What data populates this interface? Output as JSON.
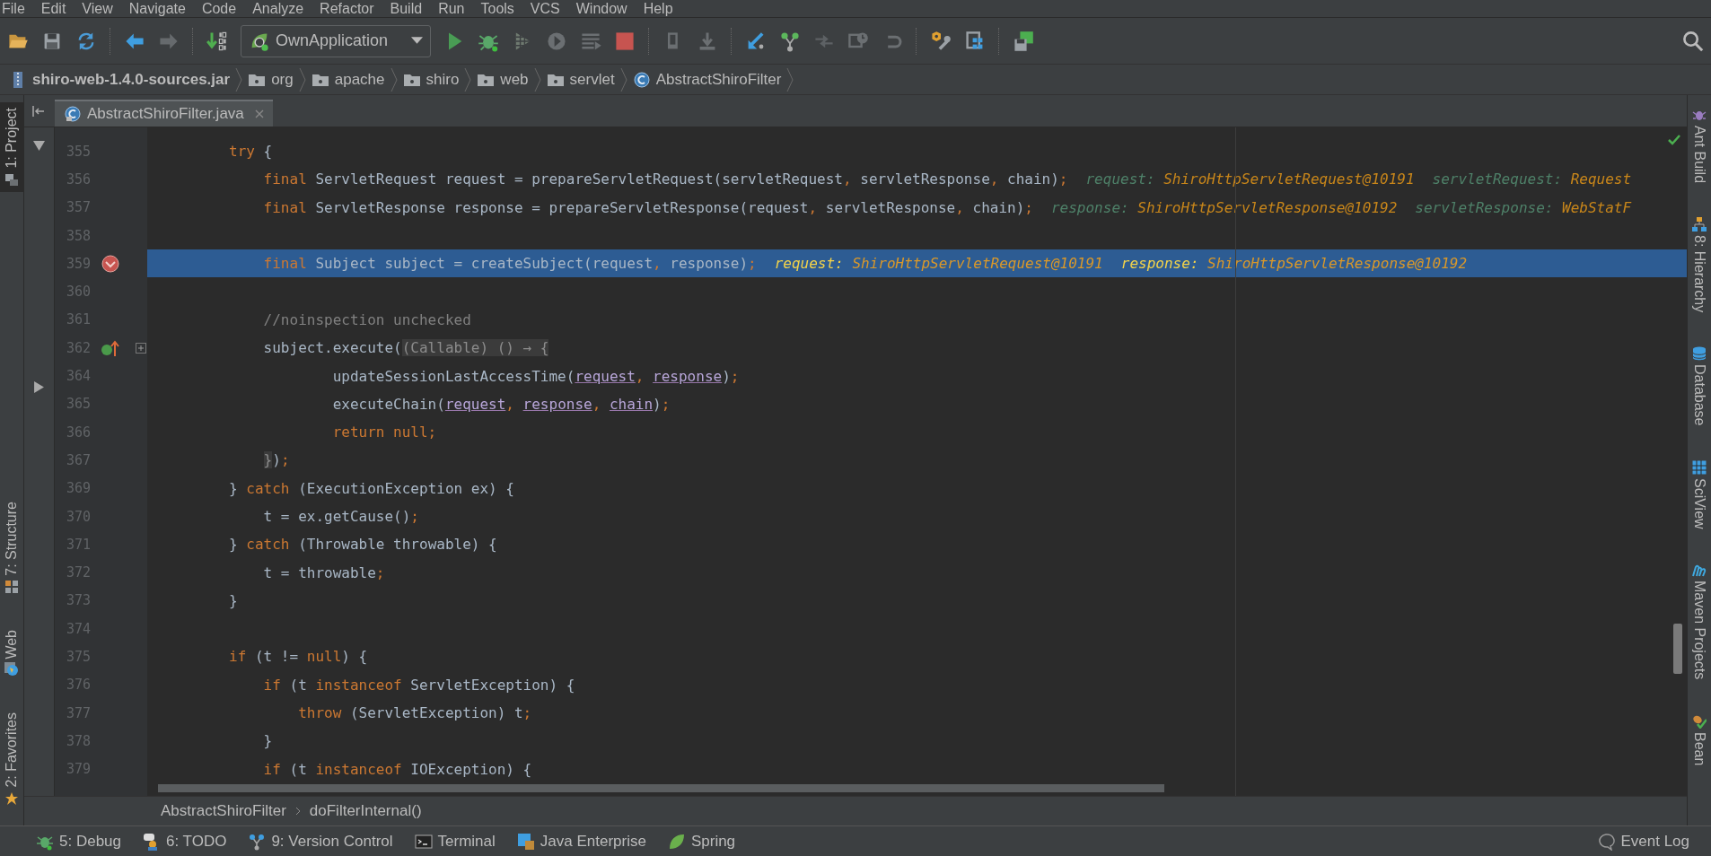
{
  "menu": [
    "File",
    "Edit",
    "View",
    "Navigate",
    "Code",
    "Analyze",
    "Refactor",
    "Build",
    "Run",
    "Tools",
    "VCS",
    "Window",
    "Help"
  ],
  "run_config": "OwnApplication",
  "navigation": [
    {
      "label": "shiro-web-1.4.0-sources.jar",
      "kind": "jar"
    },
    {
      "label": "org",
      "kind": "package"
    },
    {
      "label": "apache",
      "kind": "package"
    },
    {
      "label": "shiro",
      "kind": "package"
    },
    {
      "label": "web",
      "kind": "package"
    },
    {
      "label": "servlet",
      "kind": "package"
    },
    {
      "label": "AbstractShiroFilter",
      "kind": "class"
    }
  ],
  "left_tools": [
    {
      "label": "1: Project",
      "kind": "project",
      "selected": true
    },
    {
      "label": "7: Structure",
      "kind": "structure",
      "selected": false
    },
    {
      "label": "Web",
      "kind": "web",
      "selected": false
    },
    {
      "label": "2: Favorites",
      "kind": "favorites",
      "selected": false
    }
  ],
  "right_tools": [
    {
      "label": "Ant Build",
      "kind": "ant"
    },
    {
      "label": "8: Hierarchy",
      "kind": "hierarchy"
    },
    {
      "label": "Database",
      "kind": "database"
    },
    {
      "label": "SciView",
      "kind": "sciview"
    },
    {
      "label": "Maven Projects",
      "kind": "maven"
    },
    {
      "label": "Bean",
      "kind": "bean"
    }
  ],
  "tabs": [
    {
      "label": "AbstractShiroFilter.java",
      "selected": true
    }
  ],
  "lines": [
    {
      "number": "355",
      "selected": false,
      "fold": false,
      "breakpoint": false,
      "override": false,
      "tokens": [
        {
          "text": "        try",
          "kind": "kw"
        },
        {
          "text": " {",
          "kind": "id"
        }
      ]
    },
    {
      "number": "356",
      "selected": false,
      "fold": false,
      "breakpoint": false,
      "override": false,
      "tokens": [
        {
          "text": "            final",
          "kind": "kw"
        },
        {
          "text": " ServletRequest request = prepareServletRequest(servletRequest",
          "kind": "id"
        },
        {
          "text": ",",
          "kind": "p"
        },
        {
          "text": " servletResponse",
          "kind": "id"
        },
        {
          "text": ",",
          "kind": "p"
        },
        {
          "text": " chain)",
          "kind": "id"
        },
        {
          "text": ";",
          "kind": "p"
        }
      ],
      "hints": [
        {
          "label": "request:",
          "value": "ShiroHttpServletRequest@10191"
        },
        {
          "label": "servletRequest:",
          "value": "Request"
        }
      ]
    },
    {
      "number": "357",
      "selected": false,
      "fold": false,
      "breakpoint": false,
      "override": false,
      "tokens": [
        {
          "text": "            final",
          "kind": "kw"
        },
        {
          "text": " ServletResponse response = prepareServletResponse(request",
          "kind": "id"
        },
        {
          "text": ",",
          "kind": "p"
        },
        {
          "text": " servletResponse",
          "kind": "id"
        },
        {
          "text": ",",
          "kind": "p"
        },
        {
          "text": " chain)",
          "kind": "id"
        },
        {
          "text": ";",
          "kind": "p"
        }
      ],
      "hints": [
        {
          "label": "response:",
          "value": "ShiroHttpServletResponse@10192"
        },
        {
          "label": "servletResponse:",
          "value": "WebStatF"
        }
      ]
    },
    {
      "number": "358",
      "selected": false,
      "fold": false,
      "breakpoint": false,
      "override": false
    },
    {
      "number": "359",
      "selected": true,
      "fold": false,
      "breakpoint": true,
      "override": false,
      "tokens": [
        {
          "text": "            final",
          "kind": "kw"
        },
        {
          "text": " Subject subject = createSubject(request",
          "kind": "id"
        },
        {
          "text": ",",
          "kind": "p"
        },
        {
          "text": " response)",
          "kind": "id"
        },
        {
          "text": ";",
          "kind": "p"
        }
      ],
      "hints": [
        {
          "label": "request:",
          "value": "ShiroHttpServletRequest@10191"
        },
        {
          "label": "response:",
          "value": "ShiroHttpServletResponse@10192"
        }
      ]
    },
    {
      "number": "360",
      "selected": false,
      "fold": false,
      "breakpoint": false,
      "override": false
    },
    {
      "number": "361",
      "selected": false,
      "fold": false,
      "breakpoint": false,
      "override": false,
      "tokens": [
        {
          "text": "            //noinspection unchecked",
          "kind": "comment"
        }
      ]
    },
    {
      "number": "362",
      "selected": false,
      "fold": true,
      "breakpoint": false,
      "override": true,
      "tokens": [
        {
          "text": "            subject.execute(",
          "kind": "id"
        },
        {
          "text": "(Callable) () → {",
          "kind": "fold"
        }
      ]
    },
    {
      "number": "364",
      "selected": false,
      "fold": false,
      "breakpoint": false,
      "override": false,
      "tokens": [
        {
          "text": "                    updateSessionLastAccessTime(",
          "kind": "id"
        },
        {
          "text": "request",
          "kind": "param"
        },
        {
          "text": ", ",
          "kind": "p"
        },
        {
          "text": "response",
          "kind": "param"
        },
        {
          "text": ")",
          "kind": "id"
        },
        {
          "text": ";",
          "kind": "p"
        }
      ]
    },
    {
      "number": "365",
      "selected": false,
      "fold": false,
      "breakpoint": false,
      "override": false,
      "tokens": [
        {
          "text": "                    executeChain(",
          "kind": "id"
        },
        {
          "text": "request",
          "kind": "param"
        },
        {
          "text": ", ",
          "kind": "p"
        },
        {
          "text": "response",
          "kind": "param"
        },
        {
          "text": ", ",
          "kind": "p"
        },
        {
          "text": "chain",
          "kind": "param"
        },
        {
          "text": ")",
          "kind": "id"
        },
        {
          "text": ";",
          "kind": "p"
        }
      ]
    },
    {
      "number": "366",
      "selected": false,
      "fold": false,
      "breakpoint": false,
      "override": false,
      "tokens": [
        {
          "text": "                    return null;",
          "kind": "kw"
        }
      ]
    },
    {
      "number": "367",
      "selected": false,
      "fold": false,
      "breakpoint": false,
      "override": false,
      "tokens": [
        {
          "text": "            }",
          "kind": "fold"
        },
        {
          "text": ")",
          "kind": "id"
        },
        {
          "text": ";",
          "kind": "p"
        }
      ]
    },
    {
      "number": "369",
      "selected": false,
      "fold": false,
      "breakpoint": false,
      "override": false,
      "tokens": [
        {
          "text": "        } ",
          "kind": "id"
        },
        {
          "text": "catch",
          "kind": "kw"
        },
        {
          "text": " (ExecutionException ex) {",
          "kind": "id"
        }
      ]
    },
    {
      "number": "370",
      "selected": false,
      "fold": false,
      "breakpoint": false,
      "override": false,
      "tokens": [
        {
          "text": "            t = ex.getCause()",
          "kind": "id"
        },
        {
          "text": ";",
          "kind": "p"
        }
      ]
    },
    {
      "number": "371",
      "selected": false,
      "fold": false,
      "breakpoint": false,
      "override": false,
      "tokens": [
        {
          "text": "        } ",
          "kind": "id"
        },
        {
          "text": "catch",
          "kind": "kw"
        },
        {
          "text": " (Throwable throwable) {",
          "kind": "id"
        }
      ]
    },
    {
      "number": "372",
      "selected": false,
      "fold": false,
      "breakpoint": false,
      "override": false,
      "tokens": [
        {
          "text": "            t = throwable",
          "kind": "id"
        },
        {
          "text": ";",
          "kind": "p"
        }
      ]
    },
    {
      "number": "373",
      "selected": false,
      "fold": false,
      "breakpoint": false,
      "override": false,
      "tokens": [
        {
          "text": "        }",
          "kind": "id"
        }
      ]
    },
    {
      "number": "374",
      "selected": false,
      "fold": false,
      "breakpoint": false,
      "override": false
    },
    {
      "number": "375",
      "selected": false,
      "fold": false,
      "breakpoint": false,
      "override": false,
      "tokens": [
        {
          "text": "        if",
          "kind": "kw"
        },
        {
          "text": " (t != ",
          "kind": "id"
        },
        {
          "text": "null",
          "kind": "kw"
        },
        {
          "text": ") {",
          "kind": "id"
        }
      ]
    },
    {
      "number": "376",
      "selected": false,
      "fold": false,
      "breakpoint": false,
      "override": false,
      "tokens": [
        {
          "text": "            if",
          "kind": "kw"
        },
        {
          "text": " (t ",
          "kind": "id"
        },
        {
          "text": "instanceof",
          "kind": "kw"
        },
        {
          "text": " ServletException) {",
          "kind": "id"
        }
      ]
    },
    {
      "number": "377",
      "selected": false,
      "fold": false,
      "breakpoint": false,
      "override": false,
      "tokens": [
        {
          "text": "                throw",
          "kind": "kw"
        },
        {
          "text": " (ServletException) t",
          "kind": "id"
        },
        {
          "text": ";",
          "kind": "p"
        }
      ]
    },
    {
      "number": "378",
      "selected": false,
      "fold": false,
      "breakpoint": false,
      "override": false,
      "tokens": [
        {
          "text": "            }",
          "kind": "id"
        }
      ]
    },
    {
      "number": "379",
      "selected": false,
      "fold": false,
      "breakpoint": false,
      "override": false,
      "tokens": [
        {
          "text": "            if",
          "kind": "kw"
        },
        {
          "text": " (t ",
          "kind": "id"
        },
        {
          "text": "instanceof",
          "kind": "kw"
        },
        {
          "text": " IOException) {",
          "kind": "id"
        }
      ]
    }
  ],
  "breadcrumb": [
    "AbstractShiroFilter",
    "doFilterInternal()"
  ],
  "bottom_tools": [
    {
      "label": "5: Debug",
      "kind": "debug"
    },
    {
      "label": "6: TODO",
      "kind": "todo"
    },
    {
      "label": "9: Version Control",
      "kind": "vcs"
    },
    {
      "label": "Terminal",
      "kind": "terminal"
    },
    {
      "label": "Java Enterprise",
      "kind": "javaee"
    },
    {
      "label": "Spring",
      "kind": "spring"
    }
  ],
  "event_log": "Event Log"
}
